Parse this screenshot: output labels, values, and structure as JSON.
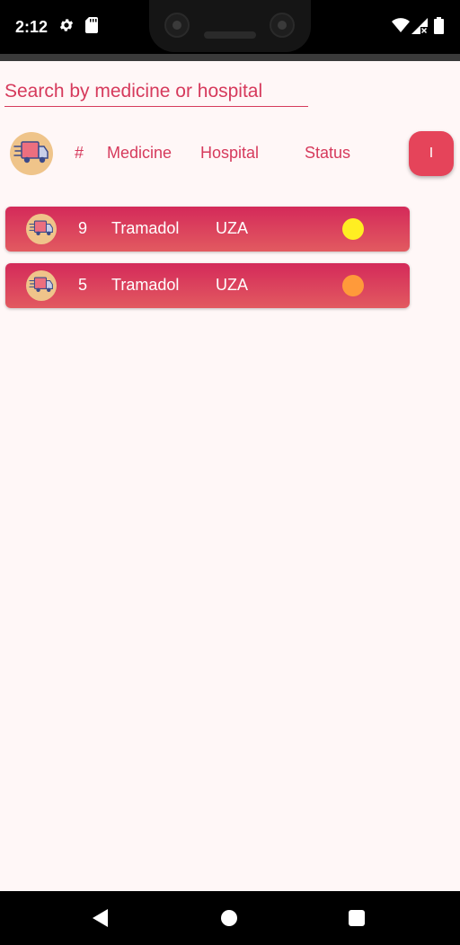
{
  "status_bar": {
    "time": "2:12",
    "icons": [
      "settings-gear-icon",
      "sd-card-icon",
      "wifi-icon",
      "signal-icon",
      "battery-icon"
    ]
  },
  "search": {
    "placeholder": "Search by medicine or hospital",
    "value": ""
  },
  "table": {
    "header_icon": "delivery-truck-icon",
    "columns": [
      "#",
      "Medicine",
      "Hospital",
      "Status"
    ],
    "info_button_label": "I",
    "rows": [
      {
        "number": "9",
        "medicine": "Tramadol",
        "hospital": "UZA",
        "status_color": "#ffee22"
      },
      {
        "number": "5",
        "medicine": "Tramadol",
        "hospital": "UZA",
        "status_color": "#ff9a3a"
      }
    ]
  },
  "nav_bar": {
    "icons": [
      "back-icon",
      "home-icon",
      "recents-icon"
    ]
  },
  "colors": {
    "accent": "#d63a5c",
    "row_top": "#d42a5a",
    "row_bottom": "#e25a60",
    "background": "#fff7f7",
    "avatar_bg": "#efc48a"
  }
}
